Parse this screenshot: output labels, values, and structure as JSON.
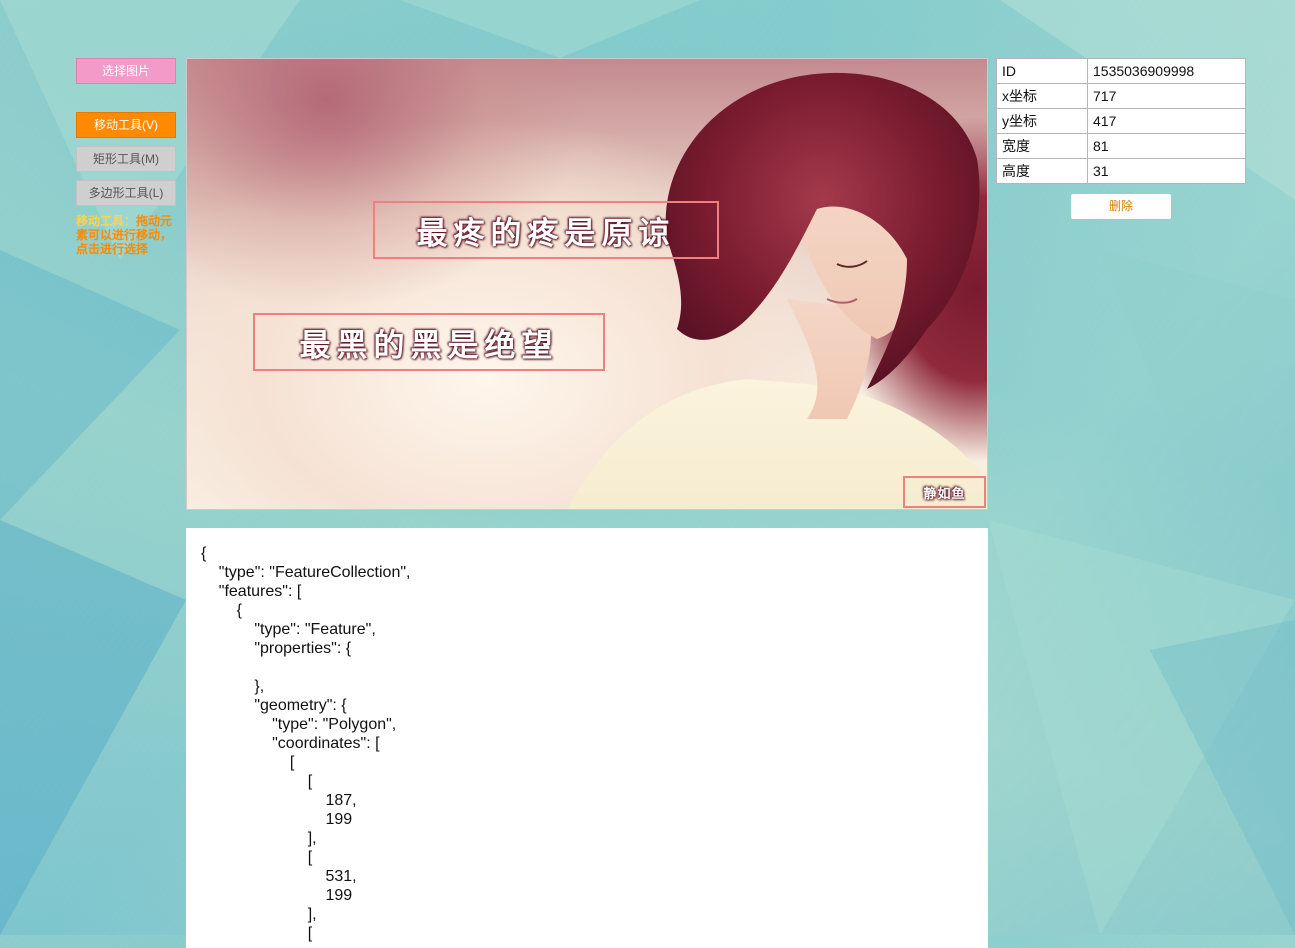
{
  "tools": {
    "select_image_label": "选择图片",
    "move_label": "移动工具(V)",
    "rect_label": "矩形工具(M)",
    "polygon_label": "多边形工具(L)",
    "help_title": "移动工具：",
    "help_text": "拖动元素可以进行移动，点击进行选择"
  },
  "canvas": {
    "annotations": [
      {
        "text": "最疼的疼是原谅"
      },
      {
        "text": "最黑的黑是绝望"
      },
      {
        "text": "静如鱼"
      }
    ]
  },
  "properties": {
    "rows": [
      {
        "key": "ID",
        "value": "1535036909998"
      },
      {
        "key": "x坐标",
        "value": "717"
      },
      {
        "key": "y坐标",
        "value": "417"
      },
      {
        "key": "宽度",
        "value": "81"
      },
      {
        "key": "高度",
        "value": "31"
      }
    ],
    "delete_label": "删除"
  },
  "json_output": {
    "text": "{\n    \"type\": \"FeatureCollection\",\n    \"features\": [\n        {\n            \"type\": \"Feature\",\n            \"properties\": {\n\n            },\n            \"geometry\": {\n                \"type\": \"Polygon\",\n                \"coordinates\": [\n                    [\n                        [\n                            187,\n                            199\n                        ],\n                        [\n                            531,\n                            199\n                        ],\n                        ["
  }
}
